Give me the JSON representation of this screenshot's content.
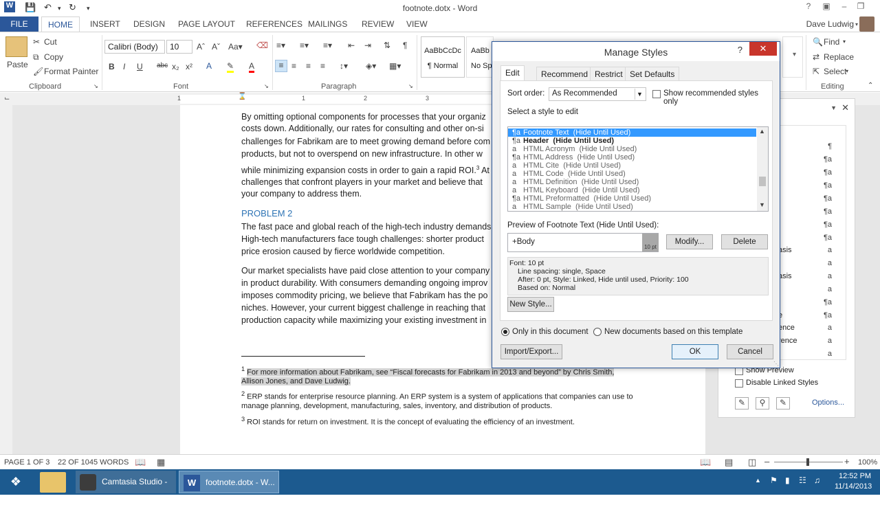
{
  "window": {
    "title": "footnote.dotx - Word"
  },
  "ribbon_tabs": [
    "FILE",
    "HOME",
    "INSERT",
    "DESIGN",
    "PAGE LAYOUT",
    "REFERENCES",
    "MAILINGS",
    "REVIEW",
    "VIEW"
  ],
  "user": "Dave Ludwig",
  "clipboard": {
    "paste": "Paste",
    "cut": "Cut",
    "copy": "Copy",
    "format_painter": "Format Painter",
    "label": "Clipboard"
  },
  "font": {
    "name": "Calibri (Body)",
    "size": "10",
    "label": "Font"
  },
  "paragraph": {
    "label": "Paragraph"
  },
  "styles": {
    "items": [
      {
        "preview": "AaBbCcDc",
        "name": "¶ Normal"
      },
      {
        "preview": "AaBb",
        "name": "No Sp"
      }
    ]
  },
  "editing": {
    "find": "Find",
    "replace": "Replace",
    "select": "Select",
    "label": "Editing"
  },
  "ruler_numbers": [
    "1",
    "1",
    "2",
    "3"
  ],
  "document": {
    "lines": [
      "By omitting optional components for processes that your organiz",
      "costs down. Additionally, our rates for consulting and other on-si",
      "challenges for Fabrikam are to meet growing demand before com",
      "products, but not to overspend on new infrastructure. In other w",
      "while minimizing expansion costs in order to gain a rapid ROI.",
      "challenges that confront players in your market and believe that",
      "your company to address them."
    ],
    "roi_sup": "3",
    "roi_tail": " At",
    "heading": "PROBLEM 2",
    "lines2": [
      "The fast pace and global reach of the high-tech industry demands",
      "High-tech manufacturers face tough challenges: shorter product",
      "price erosion caused by fierce worldwide competition."
    ],
    "lines3": [
      "Our market specialists have paid close attention to your company",
      "in product durability. With consumers demanding ongoing improv",
      "imposes commodity pricing, we believe that Fabrikam has the po",
      "niches. However, your current biggest challenge in reaching that",
      "production capacity while maximizing your existing investment in"
    ],
    "footnotes": [
      {
        "num": "1",
        "line1": "For more information about Fabrikam, see “Fiscal forecasts for Fabrikam in 2013 and beyond” by Chris Smith,",
        "line2": "Allison Jones, and Dave Ludwig."
      },
      {
        "num": "2",
        "line1": "ERP stands for enterprise resource planning. An ERP system is a system of applications that companies can use to",
        "line2": "manage planning, development, manufacturing, sales, inventory, and distribution of products."
      },
      {
        "num": "3",
        "line1": "ROI stands for return on investment. It is the concept of evaluating the efficiency of an investment.",
        "line2": ""
      }
    ]
  },
  "styles_pane": {
    "rows": [
      {
        "text": "",
        "sym": "¶"
      },
      {
        "text": "",
        "sym": "¶a"
      },
      {
        "text": "",
        "sym": "¶a"
      },
      {
        "text": "",
        "sym": "¶a"
      },
      {
        "text": "",
        "sym": "¶a"
      },
      {
        "text": "",
        "sym": "¶a"
      },
      {
        "text": "",
        "sym": "¶a"
      },
      {
        "text": "",
        "sym": "¶a"
      },
      {
        "text": "asis",
        "sym": "a"
      },
      {
        "text": "",
        "sym": "a"
      },
      {
        "text": "asis",
        "sym": "a"
      },
      {
        "text": "",
        "sym": "a"
      },
      {
        "text": "",
        "sym": "¶a"
      },
      {
        "text": "e",
        "sym": "¶a"
      },
      {
        "text": "ence",
        "sym": "a"
      },
      {
        "text": "rence",
        "sym": "a"
      },
      {
        "text": "",
        "sym": "a"
      }
    ],
    "show_preview": "Show Preview",
    "disable_linked": "Disable Linked Styles",
    "options": "Options..."
  },
  "dialog": {
    "title": "Manage Styles",
    "help": "?",
    "tabs": [
      "Edit",
      "Recommend",
      "Restrict",
      "Set Defaults"
    ],
    "sort_label": "Sort order:",
    "sort_value": "As Recommended",
    "show_recommended": "Show recommended styles only",
    "select_label": "Select a style to edit",
    "list": [
      {
        "sym": "¶a",
        "name": "Footnote Text",
        "hint": "(Hide Until Used)"
      },
      {
        "sym": "¶a",
        "name": "Header",
        "hint": "(Hide Until Used)"
      },
      {
        "sym": "a",
        "name": "HTML Acronym",
        "hint": "(Hide Until Used)"
      },
      {
        "sym": "¶a",
        "name": "HTML Address",
        "hint": "(Hide Until Used)"
      },
      {
        "sym": "a",
        "name": "HTML Cite",
        "hint": "(Hide Until Used)"
      },
      {
        "sym": "a",
        "name": "HTML Code",
        "hint": "(Hide Until Used)"
      },
      {
        "sym": "a",
        "name": "HTML Definition",
        "hint": "(Hide Until Used)"
      },
      {
        "sym": "a",
        "name": "HTML Keyboard",
        "hint": "(Hide Until Used)"
      },
      {
        "sym": "¶a",
        "name": "HTML Preformatted",
        "hint": "(Hide Until Used)"
      },
      {
        "sym": "a",
        "name": "HTML Sample",
        "hint": "(Hide Until Used)"
      }
    ],
    "preview_label": "Preview of Footnote Text  (Hide Until Used):",
    "preview_text": "+Body",
    "preview_size": "10 pt",
    "modify": "Modify...",
    "delete": "Delete",
    "desc": [
      "Font: 10 pt",
      "Line spacing:  single, Space",
      "After:  0 pt, Style: Linked, Hide until used, Priority: 100",
      "Based on: Normal"
    ],
    "new_style": "New Style...",
    "only_doc": "Only in this document",
    "new_docs": "New documents based on this template",
    "import_export": "Import/Export...",
    "ok": "OK",
    "cancel": "Cancel"
  },
  "status": {
    "page": "PAGE 1 OF 3",
    "words": "22 OF 1045 WORDS",
    "zoom": "100%"
  },
  "taskbar": {
    "apps": [
      "Camtasia Studio - ...",
      "footnote.dotx - W..."
    ],
    "time": "12:52 PM",
    "date": "11/14/2013"
  }
}
